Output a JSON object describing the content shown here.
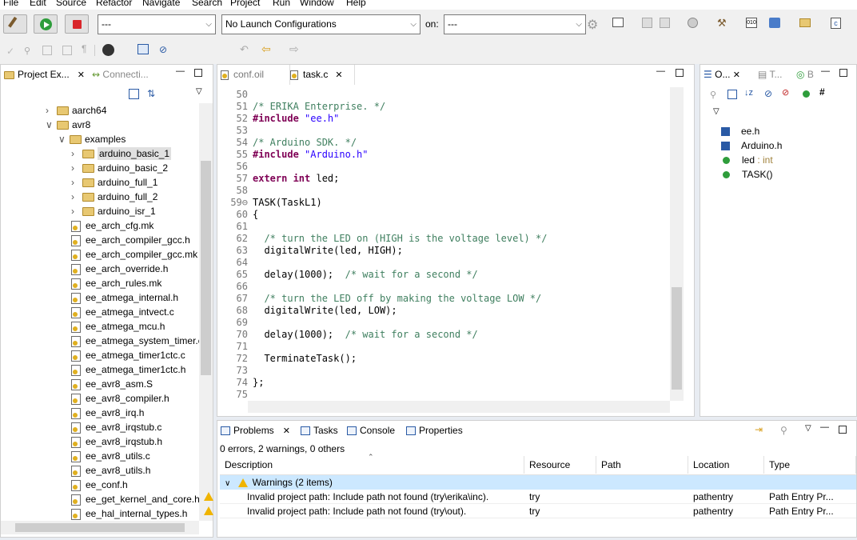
{
  "menu": [
    "File",
    "Edit",
    "Source",
    "Refactor",
    "Navigate",
    "Search",
    "Project",
    "Run",
    "Window",
    "Help"
  ],
  "toolbar": {
    "mode_combo": "---",
    "launch_combo": "No Launch Configurations",
    "on_label": "on:",
    "target_combo": "---"
  },
  "project_explorer": {
    "tab1": "Project Ex...",
    "tab2": "Connecti...",
    "items": [
      {
        "label": "aarch64",
        "kind": "folder",
        "depth": 1,
        "expander": ">"
      },
      {
        "label": "avr8",
        "kind": "folder",
        "depth": 1,
        "expander": "v"
      },
      {
        "label": "examples",
        "kind": "folder",
        "depth": 2,
        "expander": "v"
      },
      {
        "label": "arduino_basic_1",
        "kind": "folder",
        "depth": 3,
        "expander": ">",
        "selected": true
      },
      {
        "label": "arduino_basic_2",
        "kind": "folder",
        "depth": 3,
        "expander": ">"
      },
      {
        "label": "arduino_full_1",
        "kind": "folder",
        "depth": 3,
        "expander": ">"
      },
      {
        "label": "arduino_full_2",
        "kind": "folder",
        "depth": 3,
        "expander": ">"
      },
      {
        "label": "arduino_isr_1",
        "kind": "folder",
        "depth": 3,
        "expander": ">"
      },
      {
        "label": "ee_arch_cfg.mk",
        "kind": "file",
        "depth": 2
      },
      {
        "label": "ee_arch_compiler_gcc.h",
        "kind": "file",
        "depth": 2
      },
      {
        "label": "ee_arch_compiler_gcc.mk",
        "kind": "file",
        "depth": 2
      },
      {
        "label": "ee_arch_override.h",
        "kind": "file",
        "depth": 2
      },
      {
        "label": "ee_arch_rules.mk",
        "kind": "file",
        "depth": 2
      },
      {
        "label": "ee_atmega_internal.h",
        "kind": "file",
        "depth": 2
      },
      {
        "label": "ee_atmega_intvect.c",
        "kind": "file",
        "depth": 2
      },
      {
        "label": "ee_atmega_mcu.h",
        "kind": "file",
        "depth": 2
      },
      {
        "label": "ee_atmega_system_timer.c",
        "kind": "file",
        "depth": 2
      },
      {
        "label": "ee_atmega_timer1ctc.c",
        "kind": "file",
        "depth": 2
      },
      {
        "label": "ee_atmega_timer1ctc.h",
        "kind": "file",
        "depth": 2
      },
      {
        "label": "ee_avr8_asm.S",
        "kind": "file",
        "depth": 2
      },
      {
        "label": "ee_avr8_compiler.h",
        "kind": "file",
        "depth": 2
      },
      {
        "label": "ee_avr8_irq.h",
        "kind": "file",
        "depth": 2
      },
      {
        "label": "ee_avr8_irqstub.c",
        "kind": "file",
        "depth": 2
      },
      {
        "label": "ee_avr8_irqstub.h",
        "kind": "file",
        "depth": 2
      },
      {
        "label": "ee_avr8_utils.c",
        "kind": "file",
        "depth": 2
      },
      {
        "label": "ee_avr8_utils.h",
        "kind": "file",
        "depth": 2
      },
      {
        "label": "ee_conf.h",
        "kind": "file",
        "depth": 2
      },
      {
        "label": "ee_get_kernel_and_core.h",
        "kind": "file",
        "depth": 2
      },
      {
        "label": "ee_hal_internal_types.h",
        "kind": "file",
        "depth": 2
      }
    ]
  },
  "editor": {
    "tab_inactive": "conf.oil",
    "tab_active": "task.c",
    "lines": [
      {
        "n": "50",
        "parts": []
      },
      {
        "n": "51",
        "parts": [
          {
            "t": "/* ERIKA Enterprise. */",
            "c": "cm"
          }
        ]
      },
      {
        "n": "52",
        "parts": [
          {
            "t": "#include ",
            "c": "kw"
          },
          {
            "t": "\"ee.h\"",
            "c": "st"
          }
        ]
      },
      {
        "n": "53",
        "parts": []
      },
      {
        "n": "54",
        "parts": [
          {
            "t": "/* Arduino SDK. */",
            "c": "cm"
          }
        ]
      },
      {
        "n": "55",
        "parts": [
          {
            "t": "#include ",
            "c": "kw"
          },
          {
            "t": "\"Arduino.h\"",
            "c": "st"
          }
        ]
      },
      {
        "n": "56",
        "parts": []
      },
      {
        "n": "57",
        "parts": [
          {
            "t": "extern ",
            "c": "kw"
          },
          {
            "t": "int ",
            "c": "kw"
          },
          {
            "t": "led;",
            "c": ""
          }
        ]
      },
      {
        "n": "58",
        "parts": []
      },
      {
        "n": "59⊖",
        "parts": [
          {
            "t": "TASK(TaskL1)",
            "c": ""
          }
        ]
      },
      {
        "n": "60",
        "parts": [
          {
            "t": "{",
            "c": ""
          }
        ]
      },
      {
        "n": "61",
        "parts": []
      },
      {
        "n": "62",
        "parts": [
          {
            "t": "  /* turn the LED on (HIGH is the voltage level) */",
            "c": "cm"
          }
        ]
      },
      {
        "n": "63",
        "parts": [
          {
            "t": "  digitalWrite(led, HIGH);",
            "c": ""
          }
        ]
      },
      {
        "n": "64",
        "parts": []
      },
      {
        "n": "65",
        "parts": [
          {
            "t": "  delay(1000);  ",
            "c": ""
          },
          {
            "t": "/* wait for a second */",
            "c": "cm"
          }
        ]
      },
      {
        "n": "66",
        "parts": []
      },
      {
        "n": "67",
        "parts": [
          {
            "t": "  /* turn the LED off by making the voltage LOW */",
            "c": "cm"
          }
        ]
      },
      {
        "n": "68",
        "parts": [
          {
            "t": "  digitalWrite(led, LOW);",
            "c": ""
          }
        ]
      },
      {
        "n": "69",
        "parts": []
      },
      {
        "n": "70",
        "parts": [
          {
            "t": "  delay(1000);  ",
            "c": ""
          },
          {
            "t": "/* wait for a second */",
            "c": "cm"
          }
        ]
      },
      {
        "n": "71",
        "parts": []
      },
      {
        "n": "72",
        "parts": [
          {
            "t": "  TerminateTask();",
            "c": ""
          }
        ]
      },
      {
        "n": "73",
        "parts": []
      },
      {
        "n": "74",
        "parts": [
          {
            "t": "};",
            "c": ""
          }
        ]
      },
      {
        "n": "75",
        "parts": []
      }
    ]
  },
  "outline": {
    "tab1": "O...",
    "tab2": "T...",
    "tab3": "B",
    "items": [
      {
        "label": "ee.h",
        "type": ""
      },
      {
        "label": "Arduino.h",
        "type": ""
      },
      {
        "label": "led",
        "type": " : int"
      },
      {
        "label": "TASK()",
        "type": ""
      }
    ]
  },
  "problems": {
    "tabs": [
      "Problems",
      "Tasks",
      "Console",
      "Properties"
    ],
    "summary": "0 errors, 2 warnings, 0 others",
    "columns": [
      "Description",
      "Resource",
      "Path",
      "Location",
      "Type"
    ],
    "group": "Warnings (2 items)",
    "rows": [
      {
        "desc": "Invalid project path: Include path not found (try\\erika\\inc).",
        "resource": "try",
        "path": "",
        "location": "pathentry",
        "type": "Path Entry Pr..."
      },
      {
        "desc": "Invalid project path: Include path not found (try\\out).",
        "resource": "try",
        "path": "",
        "location": "pathentry",
        "type": "Path Entry Pr..."
      }
    ]
  },
  "colors": {
    "accent": "#cce8ff",
    "selected": "#e0e0e0",
    "warn": "#f0b400"
  }
}
